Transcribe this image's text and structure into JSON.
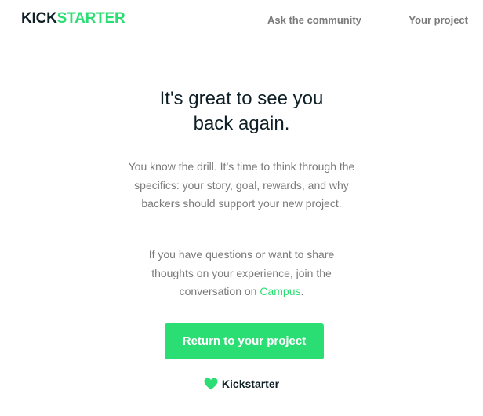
{
  "header": {
    "logo": {
      "part1": "KICK",
      "part2": "STARTER"
    },
    "nav": {
      "community": "Ask the community",
      "project": "Your project"
    }
  },
  "main": {
    "headline_line1": "It's great to see you",
    "headline_line2": "back again.",
    "paragraph1": "You know the drill. It’s time to think through the specifics: your story, goal, rewards, and why backers should support your new project.",
    "paragraph2_prefix": "If you have questions or want to share thoughts on your experience, join the conversation on ",
    "paragraph2_link": "Campus",
    "paragraph2_suffix": ".",
    "cta_label": "Return to your project"
  },
  "footer": {
    "brand_label": "Kickstarter",
    "icon": "heart-icon"
  },
  "colors": {
    "brand_green": "#2bde73",
    "brand_dark": "#0f1f26",
    "muted_text": "#7a7a7a"
  }
}
